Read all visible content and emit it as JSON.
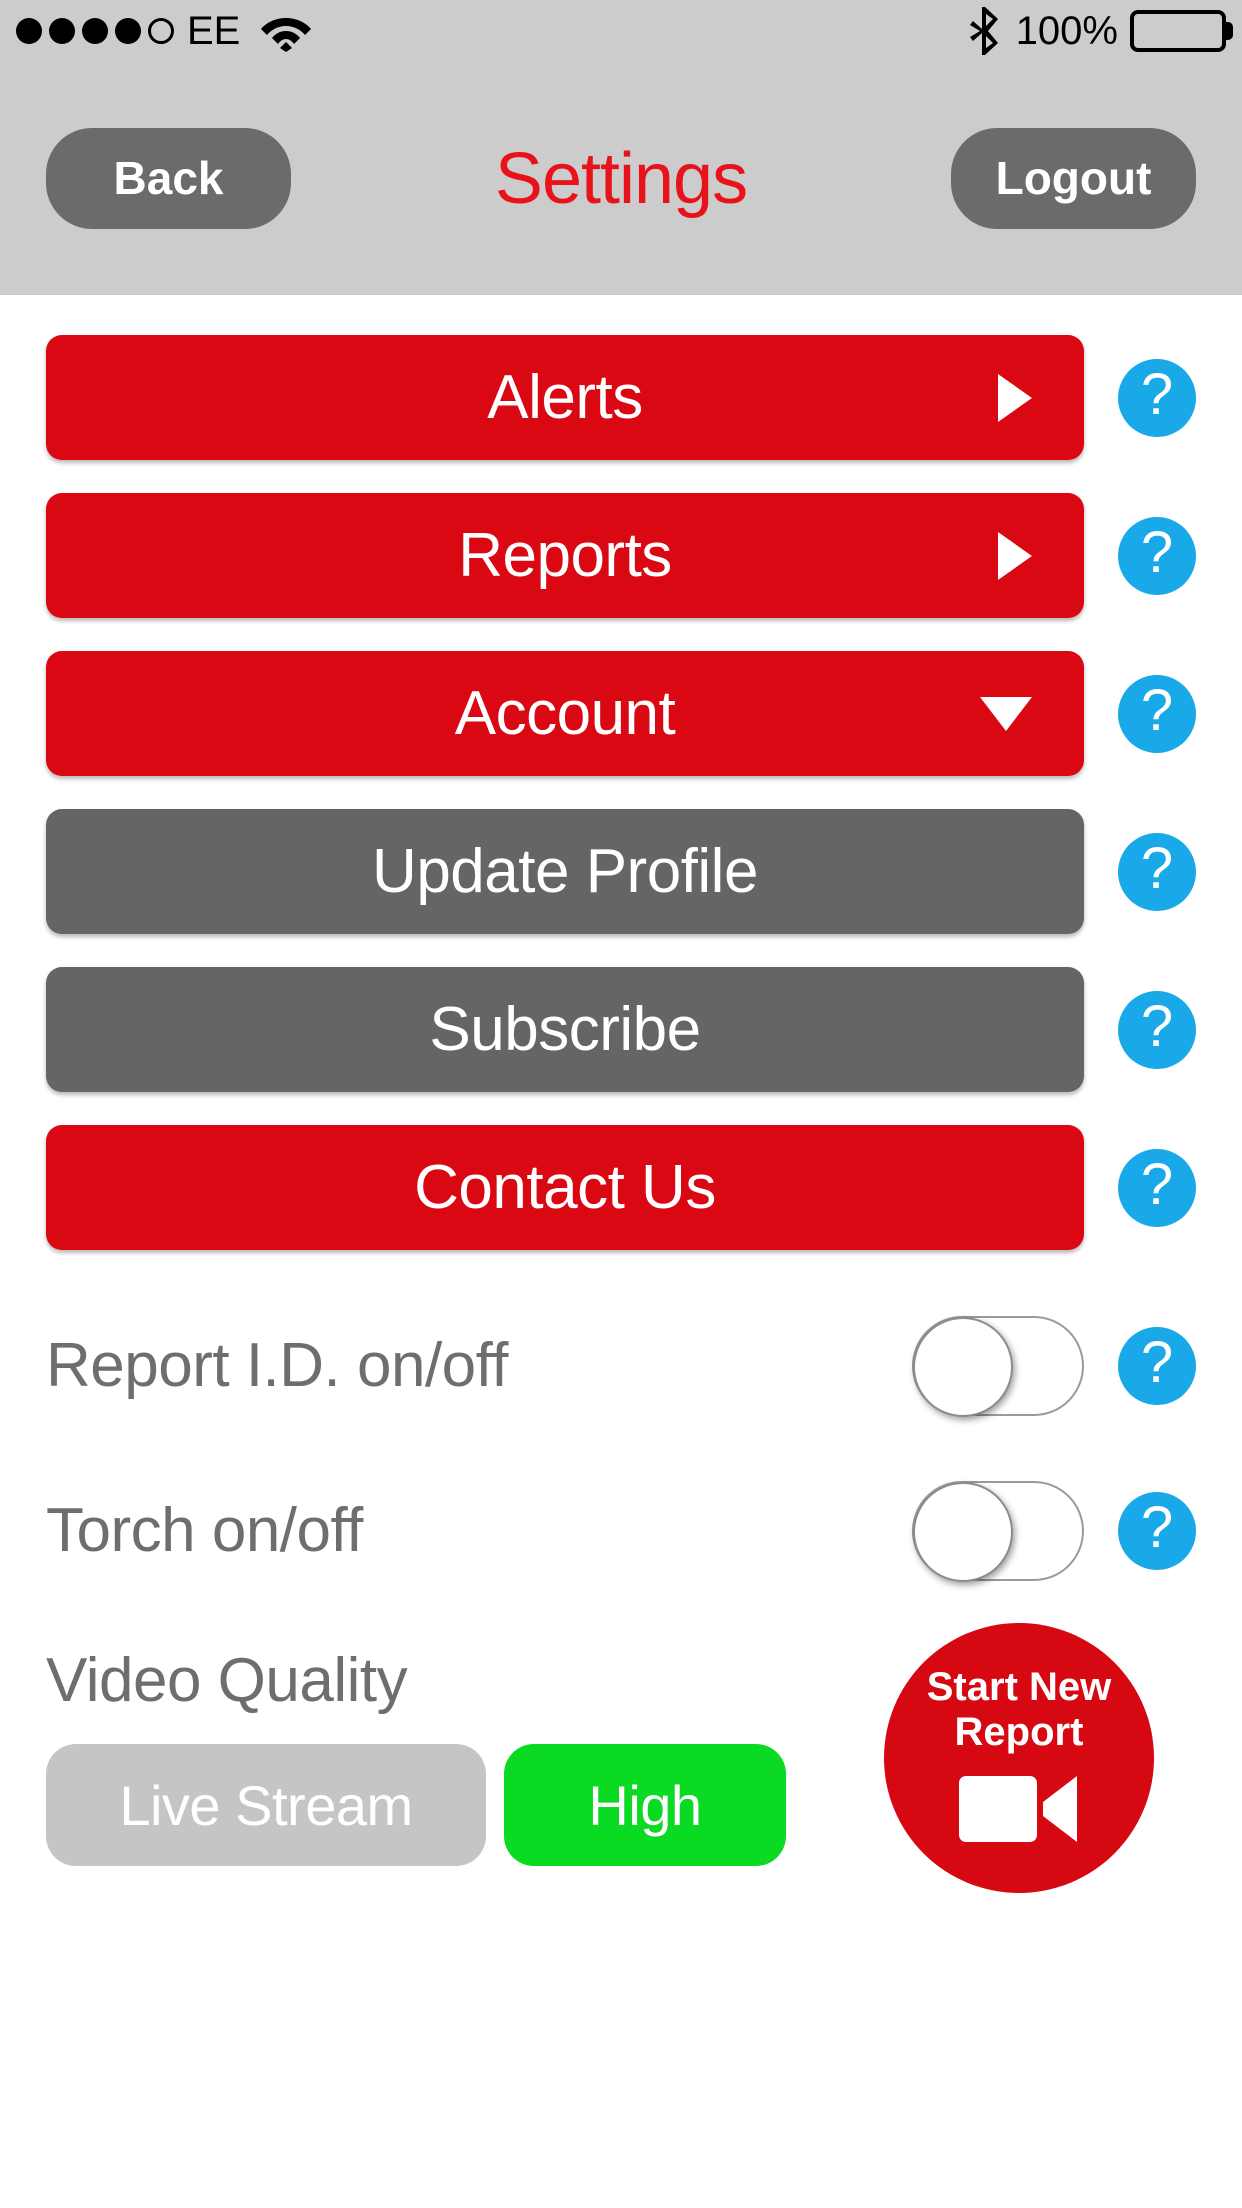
{
  "statusbar": {
    "signal_dots_filled": 4,
    "signal_dots_total": 5,
    "carrier": "EE",
    "wifi_icon": "wifi-icon",
    "bluetooth_icon": "bluetooth-icon",
    "battery_percent": "100%",
    "battery_icon": "battery-full-icon"
  },
  "navbar": {
    "back_label": "Back",
    "title": "Settings",
    "logout_label": "Logout",
    "title_color": "#E8121B",
    "background": "#CCCCCC"
  },
  "menu": {
    "items": [
      {
        "label": "Alerts",
        "style": "red",
        "arrow": "right",
        "help": "?"
      },
      {
        "label": "Reports",
        "style": "red",
        "arrow": "right",
        "help": "?"
      },
      {
        "label": "Account",
        "style": "red",
        "arrow": "down",
        "help": "?"
      },
      {
        "label": "Update Profile",
        "style": "gray",
        "arrow": "none",
        "help": "?"
      },
      {
        "label": "Subscribe",
        "style": "gray",
        "arrow": "none",
        "help": "?"
      },
      {
        "label": "Contact Us",
        "style": "red",
        "arrow": "none",
        "help": "?"
      }
    ]
  },
  "toggles": [
    {
      "label": "Report I.D. on/off",
      "state": "off",
      "help": "?"
    },
    {
      "label": "Torch on/off",
      "state": "off",
      "help": "?"
    }
  ],
  "video_quality": {
    "title": "Video Quality",
    "options": [
      {
        "label": "Live Stream",
        "active": false
      },
      {
        "label": "High",
        "active": true
      }
    ]
  },
  "start_report": {
    "label": "Start New\nReport",
    "icon": "video-camera-icon",
    "color": "#D60812"
  },
  "colors": {
    "red": "#DA0812",
    "gray": "#656565",
    "help_blue": "#19A9E8",
    "green": "#0ADA22",
    "inactive_gray": "#C5C5C5"
  }
}
